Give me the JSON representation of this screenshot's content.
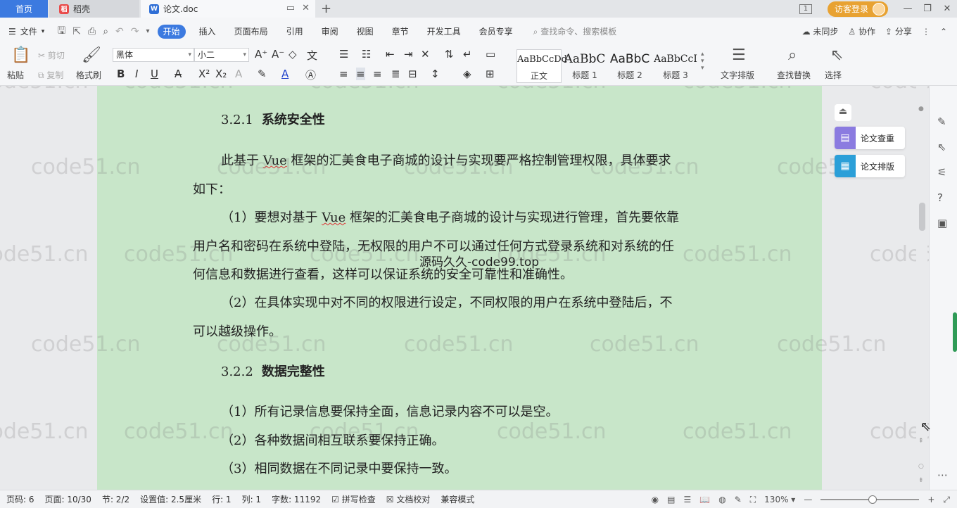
{
  "titlebar": {
    "home_tab": "首页",
    "daoke_tab": "稻壳",
    "doc_tab": "论文.doc",
    "visitor_login": "访客登录",
    "page_badge": "1"
  },
  "menu": {
    "file": "文件",
    "tabs": [
      "开始",
      "插入",
      "页面布局",
      "引用",
      "审阅",
      "视图",
      "章节",
      "开发工具",
      "会员专享"
    ],
    "search_placeholder": "查找命令、搜索模板",
    "sync": "未同步",
    "collab": "协作",
    "share": "分享"
  },
  "ribbon": {
    "paste": "粘贴",
    "cut": "剪切",
    "copy": "复制",
    "format_painter": "格式刷",
    "font_name": "黑体",
    "font_size": "小二",
    "styles": [
      {
        "sample": "AaBbCcDd",
        "label": "正文"
      },
      {
        "sample": "AaBbC",
        "label": "标题 1"
      },
      {
        "sample": "AaBbC",
        "label": "标题 2"
      },
      {
        "sample": "AaBbCcI",
        "label": "标题 3"
      }
    ],
    "text_layout": "文字排版",
    "find_replace": "查找替换",
    "select": "选择"
  },
  "document": {
    "h321_num": "3.2.1",
    "h321_title": "系统安全性",
    "p1_a": "此基于 ",
    "p1_vue": "Vue",
    "p1_b": " 框架的汇美食电子商城的设计与实现要严格控制管理权限，具体要求",
    "p1_line2": "如下：",
    "p2_a": "（1）要想对基于 ",
    "p2_vue": "Vue",
    "p2_b": " 框架的汇美食电子商城的设计与实现进行管理，首先要依靠",
    "p2_line2": "用户名和密码在系统中登陆，无权限的用户不可以通过任何方式登录系统和对系统的任",
    "p2_line3": "何信息和数据进行查看，这样可以保证系统的安全可靠性和准确性。",
    "p3_line1": "（2）在具体实现中对不同的权限进行设定，不同权限的用户在系统中登陆后，不",
    "p3_line2": "可以越级操作。",
    "h322_num": "3.2.2",
    "h322_title": "数据完整性",
    "l1": "（1）所有记录信息要保持全面，信息记录内容不可以是空。",
    "l2": "（2）各种数据间相互联系要保持正确。",
    "l3": "（3）相同数据在不同记录中要保持一致。",
    "overlay": "源码久久-code99.top"
  },
  "watermark": "code51.cn",
  "side_panel": {
    "check": "论文查重",
    "layout": "论文排版"
  },
  "status": {
    "page_no": "页码: 6",
    "pages": "页面: 10/30",
    "section": "节: 2/2",
    "setting": "设置值: 2.5厘米",
    "row": "行: 1",
    "col": "列: 1",
    "words": "字数: 11192",
    "spell": "拼写检查",
    "proof": "文档校对",
    "compat": "兼容模式",
    "zoom": "130%"
  },
  "colors": {
    "accent": "#3c7ae0",
    "page_bg": "#c8e6c9",
    "login_orange": "#e8a232"
  }
}
